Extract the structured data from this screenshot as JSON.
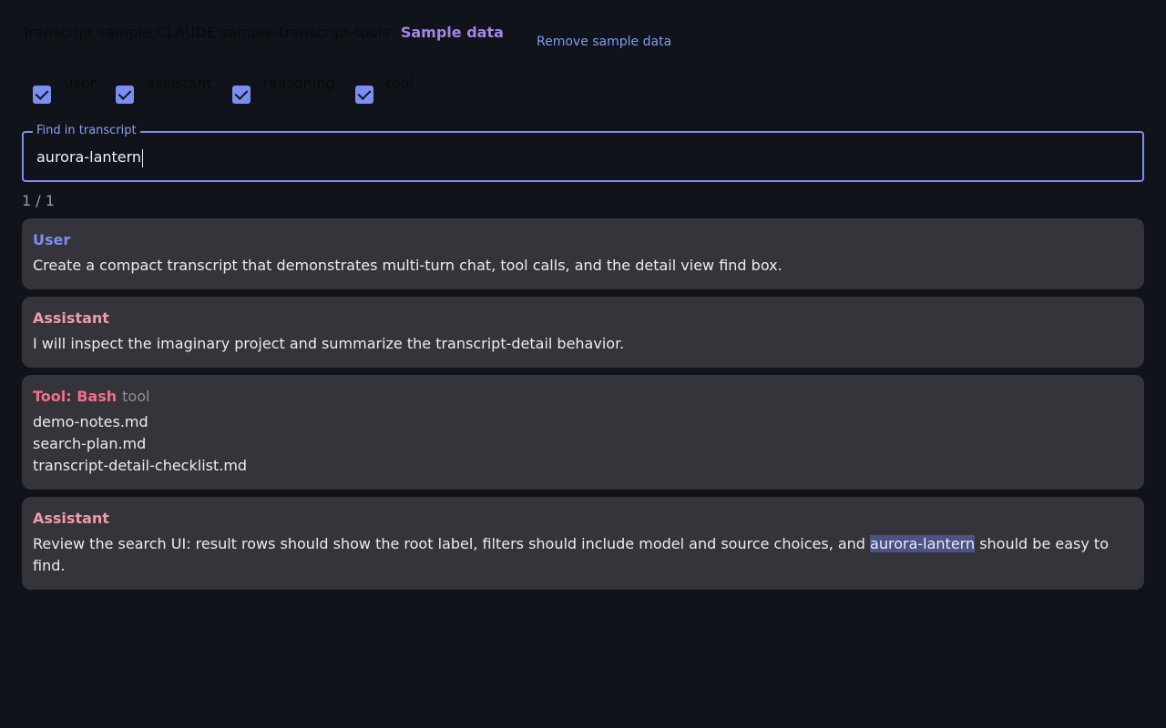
{
  "header": {
    "title": "Transcript sample:CLAUDE:sample-transcript-tools",
    "badge": "Sample data",
    "remove_link": "Remove sample data"
  },
  "filters": [
    {
      "label": "user",
      "checked": true
    },
    {
      "label": "assistant",
      "checked": true
    },
    {
      "label": "reasoning",
      "checked": true
    },
    {
      "label": "tool",
      "checked": true
    }
  ],
  "find": {
    "label": "Find in transcript",
    "value": "aurora-lantern"
  },
  "match_count": "1 / 1",
  "messages": [
    {
      "role": "User",
      "body": "Create a compact transcript that demonstrates multi-turn chat, tool calls, and the detail view find box."
    },
    {
      "role": "Assistant",
      "body": "I will inspect the imaginary project and summarize the transcript-detail behavior."
    },
    {
      "role": "Tool: Bash",
      "subrole": "tool",
      "body": "demo-notes.md\nsearch-plan.md\ntranscript-detail-checklist.md"
    },
    {
      "role": "Assistant",
      "body_before": "Review the search UI: result rows should show the root label, filters should include model and source choices, and ",
      "body_highlight": "aurora-lantern",
      "body_after": " should be easy to find."
    }
  ],
  "colors": {
    "background": "#11131a",
    "card": "#35343a",
    "accent": "#7b8ef2",
    "assistant": "#f09aaa",
    "tool": "#f0708a",
    "badge": "#a285e6",
    "highlight": "#4b5287"
  }
}
